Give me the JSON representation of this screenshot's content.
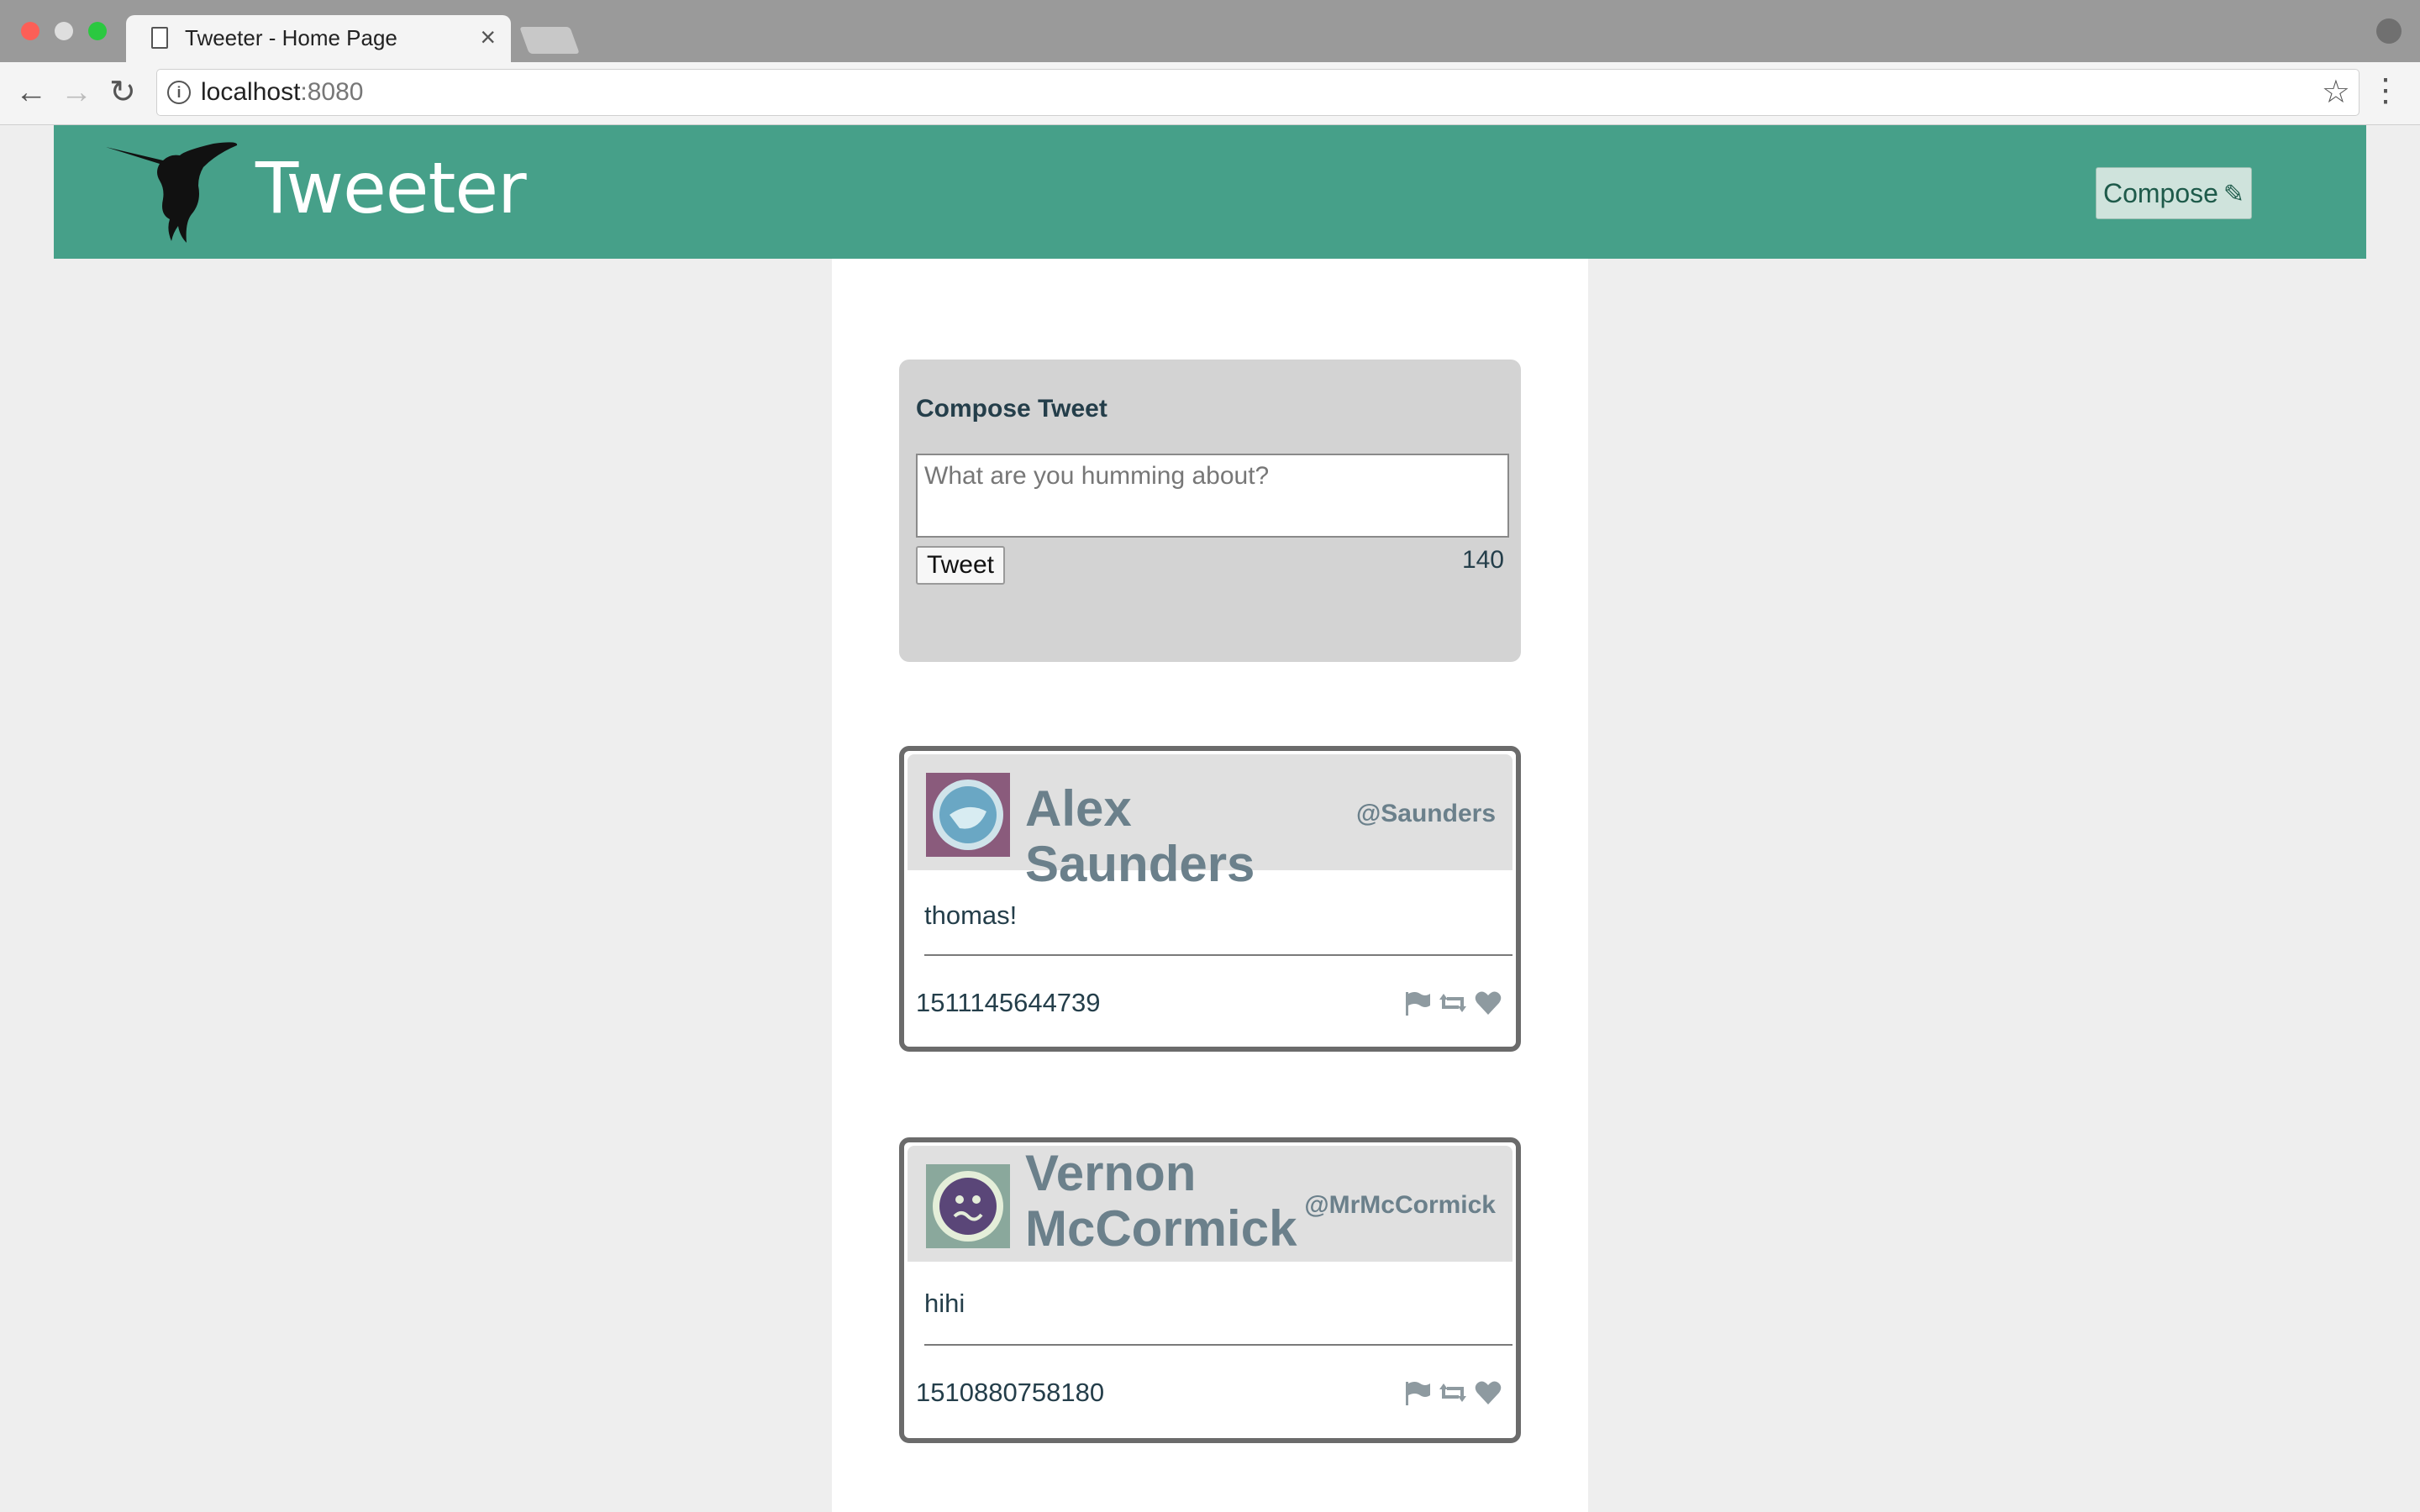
{
  "browser": {
    "tab_title": "Tweeter - Home Page",
    "tab_close": "×",
    "url_host": "localhost",
    "url_port": ":8080",
    "icons": [
      "page-icon",
      "close-icon",
      "back-icon",
      "forward-icon",
      "reload-icon",
      "info-icon",
      "star-icon",
      "menu-icon",
      "profile-icon"
    ]
  },
  "header": {
    "brand": "Tweeter",
    "compose_label": "Compose",
    "icons": [
      "hummingbird-logo",
      "edit-icon"
    ],
    "bg_color": "#46a089"
  },
  "compose": {
    "title": "Compose Tweet",
    "placeholder": "What are you humming about?",
    "button_label": "Tweet",
    "char_count": "140"
  },
  "tweets": [
    {
      "name": "Alex Saunders",
      "handle": "@Saunders",
      "text": "thomas!",
      "timestamp": "1511145644739",
      "avatar_color": "#8a5b7c",
      "actions": [
        "flag-icon",
        "retweet-icon",
        "heart-icon"
      ]
    },
    {
      "name": "Vernon McCormick",
      "handle": "@MrMcCormick",
      "text": "hihi",
      "timestamp": "1510880758180",
      "avatar_color": "#8aa89c",
      "actions": [
        "flag-icon",
        "retweet-icon",
        "heart-icon"
      ]
    }
  ]
}
